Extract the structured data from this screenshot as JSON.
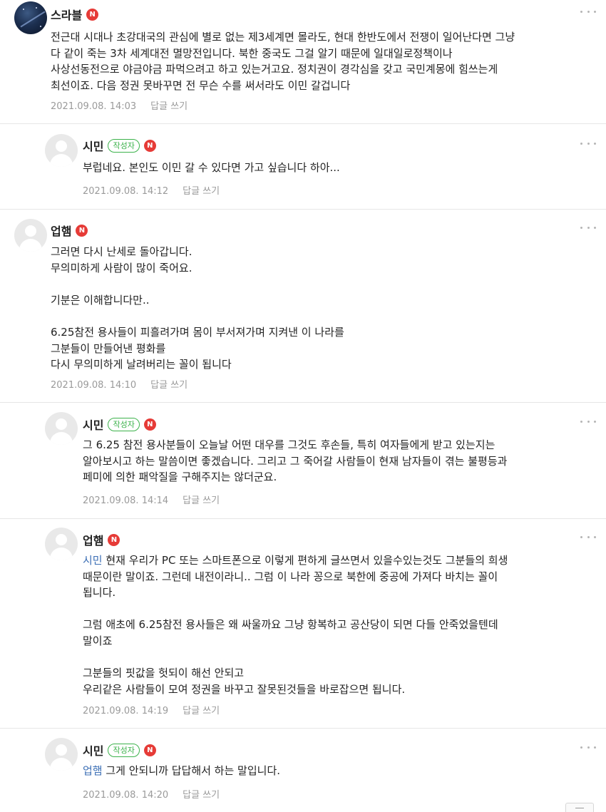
{
  "comments": [
    {
      "author": "스라블",
      "new_badge": "N",
      "text": "전근대 시대나 초강대국의 관심에 별로 없는 제3세계면 몰라도, 현대 한반도에서 전쟁이 일어난다면 그냥\n다 같이 죽는 3차 세계대전 멸망전입니다. 북한 중국도 그걸 알기 때문에 일대일로정책이나\n사상선동전으로 야금야금 파먹으려고 하고 있는거고요. 정치권이 경각심을 갖고 국민계몽에 힘쓰는게\n최선이죠. 다음 정권 못바꾸면 전 무슨 수를 써서라도 이민 갈겁니다",
      "date": "2021.09.08. 14:03",
      "reply_label": "답글 쓰기"
    },
    {
      "author": "시민",
      "author_badge": "작성자",
      "new_badge": "N",
      "text": "부럽네요. 본인도 이민 갈 수 있다면 가고 싶습니다 하아...",
      "date": "2021.09.08. 14:12",
      "reply_label": "답글 쓰기"
    },
    {
      "author": "업햄",
      "new_badge": "N",
      "text": "그러면 다시 난세로 돌아갑니다.\n무의미하게 사람이 많이 죽어요.\n\n기분은 이해합니다만..\n\n6.25참전 용사들이 피흘려가며 몸이 부서져가며 지켜낸 이 나라를\n그분들이 만들어낸 평화를\n다시 무의미하게 날려버리는 꼴이 됩니다",
      "date": "2021.09.08. 14:10",
      "reply_label": "답글 쓰기"
    },
    {
      "author": "시민",
      "author_badge": "작성자",
      "new_badge": "N",
      "text": "그 6.25 참전 용사분들이 오늘날 어떤 대우를 그것도 후손들, 특히 여자들에게 받고 있는지는\n알아보시고 하는 말씀이면 좋겠습니다. 그리고 그 죽어갈 사람들이 현재 남자들이 겪는 불평등과\n페미에 의한 패악질을 구해주지는 않더군요.",
      "date": "2021.09.08. 14:14",
      "reply_label": "답글 쓰기"
    },
    {
      "author": "업햄",
      "new_badge": "N",
      "mention": "시민",
      "text": " 현재 우리가 PC 또는 스마트폰으로 이렇게 편하게 글쓰면서 있을수있는것도 그분들의 희생\n때문이란 말이죠. 그런데 내전이라니.. 그럼 이 나라 꽁으로 북한에 중공에 가져다 바치는 꼴이\n됩니다.\n\n그럼 애초에 6.25참전 용사들은 왜 싸울까요 그냥 항복하고 공산당이 되면 다들 안죽었을텐데\n말이죠\n\n그분들의 핏값을 헛되이 해선 안되고\n우리같은 사람들이 모여 정권을 바꾸고 잘못된것들을 바로잡으면 됩니다.",
      "date": "2021.09.08. 14:19",
      "reply_label": "답글 쓰기"
    },
    {
      "author": "시민",
      "author_badge": "작성자",
      "new_badge": "N",
      "mention": "업햄",
      "text": " 그게 안되니까 답답해서 하는 말입니다.",
      "date": "2021.09.08. 14:20",
      "reply_label": "답글 쓰기"
    }
  ]
}
